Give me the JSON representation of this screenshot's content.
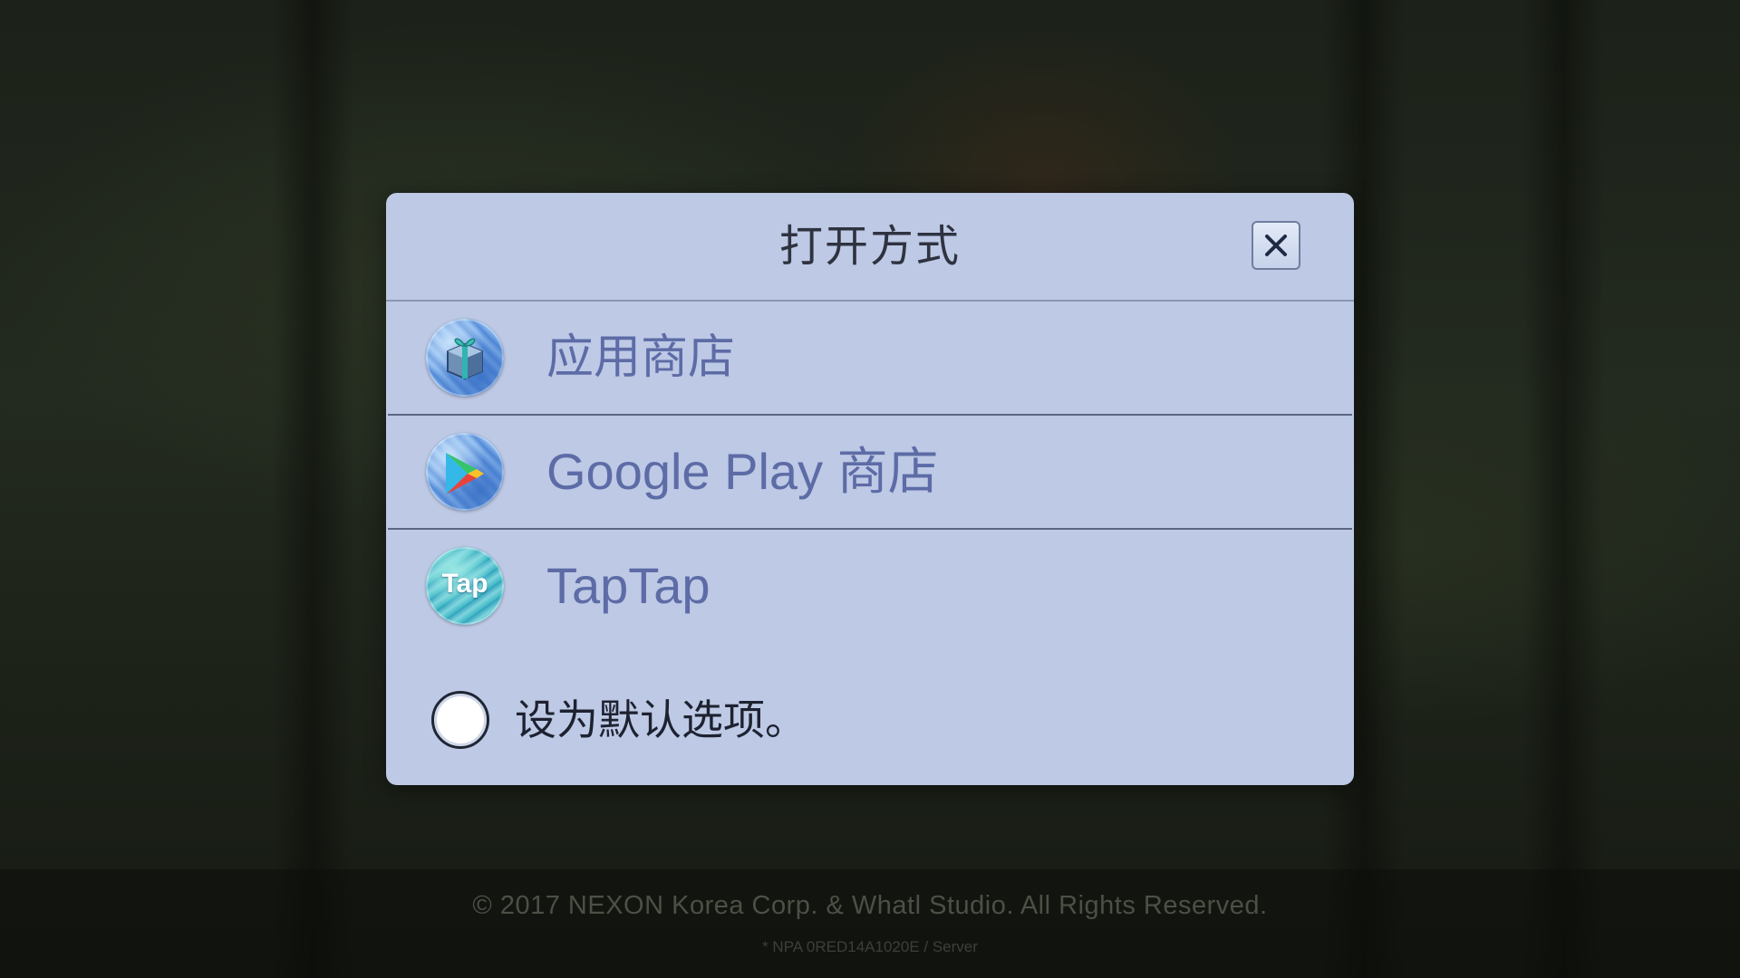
{
  "dialog": {
    "title": "打开方式",
    "close_icon": "close-icon",
    "options": [
      {
        "label": "应用商店",
        "icon": "app-store-gift-icon"
      },
      {
        "label": "Google Play 商店",
        "icon": "google-play-icon"
      },
      {
        "label": "TapTap",
        "icon": "taptap-icon",
        "icon_text": "Tap"
      }
    ],
    "default_option": {
      "label": "设为默认选项。",
      "checked": false
    },
    "colors": {
      "dialog_bg": "#bdc9e5",
      "option_text": "#5d6ba6",
      "title_text": "#2f3340"
    }
  },
  "background": {
    "copyright": "© 2017 NEXON Korea Corp. & Whatl Studio. All Rights Reserved.",
    "server_info": "* NPA 0RED14A1020E / Server"
  }
}
